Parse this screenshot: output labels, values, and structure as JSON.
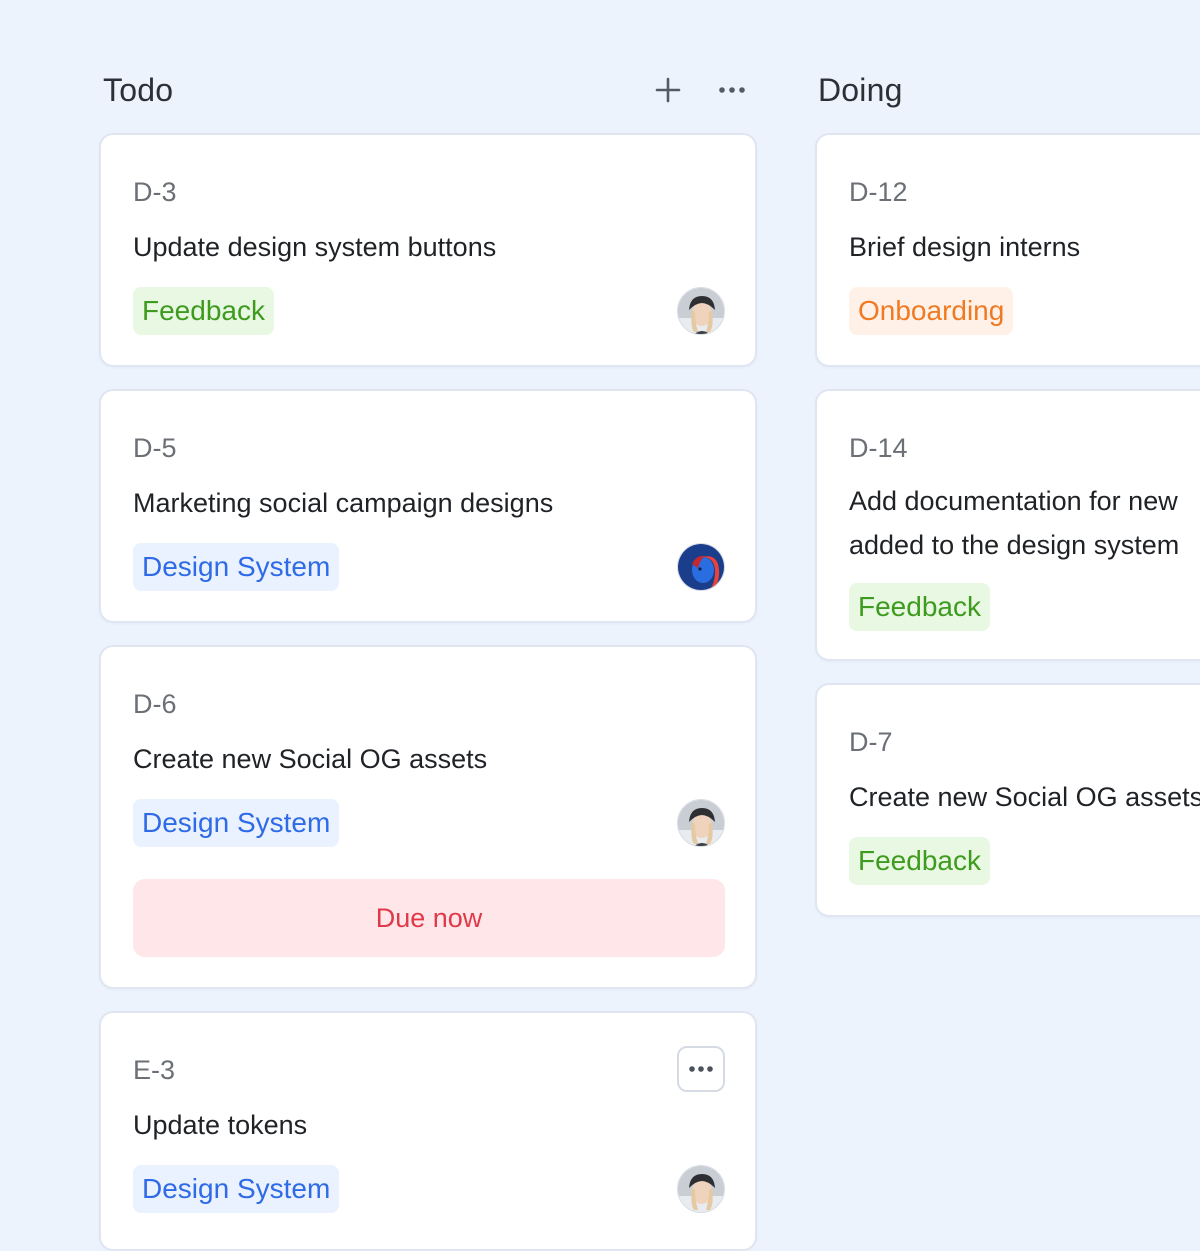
{
  "columns": [
    {
      "title": "Todo",
      "cards": [
        {
          "id": "D-3",
          "title": "Update design system buttons",
          "tag": "Feedback"
        },
        {
          "id": "D-5",
          "title": "Marketing social campaign designs",
          "tag": "Design System"
        },
        {
          "id": "D-6",
          "title": "Create new Social OG assets",
          "tag": "Design System",
          "due": "Due now"
        },
        {
          "id": "E-3",
          "title": "Update tokens",
          "tag": "Design System"
        }
      ]
    },
    {
      "title": "Doing",
      "cards": [
        {
          "id": "D-12",
          "title": "Brief design interns",
          "tag": "Onboarding"
        },
        {
          "id": "D-14",
          "title_lines": [
            "Add documentation for new",
            "added to the design system"
          ],
          "tag": "Feedback"
        },
        {
          "id": "D-7",
          "title": "Create new Social OG assets",
          "tag": "Feedback"
        }
      ]
    }
  ],
  "icons": {
    "add": "plus-icon",
    "more": "more-horizontal-icon",
    "avatar_a": "avatar-woman-beanie",
    "avatar_b": "avatar-woman-red-blue-light"
  },
  "colors": {
    "background": "#edf3fd",
    "tag_green_text": "#3f9b1f",
    "tag_blue_text": "#2f6be6",
    "tag_orange_text": "#f07a22",
    "due_text": "#e0394a",
    "due_bg": "#ffe6e8"
  }
}
